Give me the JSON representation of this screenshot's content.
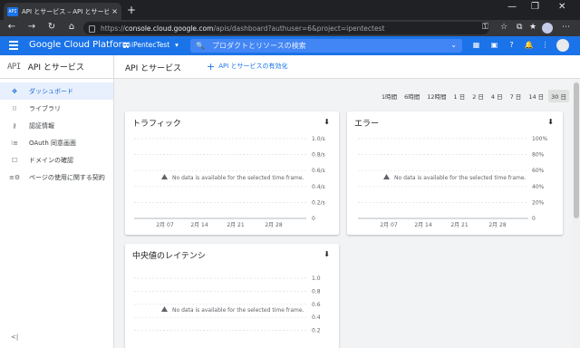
{
  "browser": {
    "tab_favicon": "API",
    "tab_title": "API とサービス – API とサービス – iPe",
    "tab_close": "×",
    "new_tab": "+",
    "window_controls": [
      "—",
      "❐",
      "✕"
    ],
    "nav": {
      "back": "←",
      "forward": "→",
      "reload": "↻",
      "home": "⌂"
    },
    "url_prefix": "https://",
    "url_host": "console.cloud.google.com",
    "url_path": "/apis/dashboard?authuser=6&project=ipentectest",
    "toolbar_icons": [
      "key-icon",
      "star-icon",
      "collections-icon",
      "favorites-icon",
      "extensions-icon"
    ],
    "toolbar_glyphs": [
      "⚿",
      "☆",
      "⧉",
      "★",
      "▣"
    ],
    "menu": "⋯"
  },
  "gcp": {
    "title": "Google Cloud Platform",
    "project": "iPentecTest",
    "project_chevron": "▾",
    "search_icon": "🔍",
    "search_placeholder": "プロダクトとリソースの検索",
    "search_chevron": "⌄",
    "header_icons": [
      "▦",
      "▣",
      "?",
      "🔔",
      "⋮"
    ]
  },
  "sidebar": {
    "logo": "API",
    "title": "API とサービス",
    "items": [
      {
        "icon": "✥",
        "label": "ダッシュボード",
        "active": true
      },
      {
        "icon": "⁞⁞",
        "label": "ライブラリ"
      },
      {
        "icon": "⚷",
        "label": "認証情報"
      },
      {
        "icon": "⁝≡",
        "label": "OAuth 同意画面"
      },
      {
        "icon": "☐",
        "label": "ドメインの確認"
      },
      {
        "icon": "≡⚙",
        "label": "ページの使用に関する契約"
      }
    ],
    "collapse": "<|"
  },
  "main": {
    "title": "API とサービス",
    "enable_label": "API とサービスの有効化",
    "enable_plus": "+",
    "ranges": [
      "1時間",
      "6時間",
      "12時間",
      "1 日",
      "2 日",
      "4 日",
      "7 日",
      "14 日",
      "30 日"
    ],
    "selected_range": "30 日",
    "download_icon": "⬇"
  },
  "chart_data": [
    {
      "type": "line",
      "title": "トラフィック",
      "x_ticks": [
        "2月 07",
        "2月 14",
        "2月 21",
        "2月 28"
      ],
      "y_ticks": [
        "0",
        "0.2/s",
        "0.4/s",
        "0.6/s",
        "0.8/s",
        "1.0/s"
      ],
      "ylim": [
        0,
        1.0
      ],
      "grid": true,
      "series": [],
      "empty_message": "No data is available for the selected time frame."
    },
    {
      "type": "line",
      "title": "エラー",
      "x_ticks": [
        "2月 07",
        "2月 14",
        "2月 21",
        "2月 28"
      ],
      "y_ticks": [
        "0",
        "20%",
        "40%",
        "60%",
        "80%",
        "100%"
      ],
      "ylim": [
        0,
        100
      ],
      "grid": true,
      "series": [],
      "empty_message": "No data is available for the selected time frame."
    },
    {
      "type": "line",
      "title": "中央値のレイテンシ",
      "x_ticks": [],
      "y_ticks": [
        "0.2",
        "0.4",
        "0.6",
        "0.8",
        "1.0"
      ],
      "ylim": [
        0,
        1.0
      ],
      "grid": true,
      "series": [],
      "empty_message": "No data is available for the selected time frame."
    }
  ]
}
